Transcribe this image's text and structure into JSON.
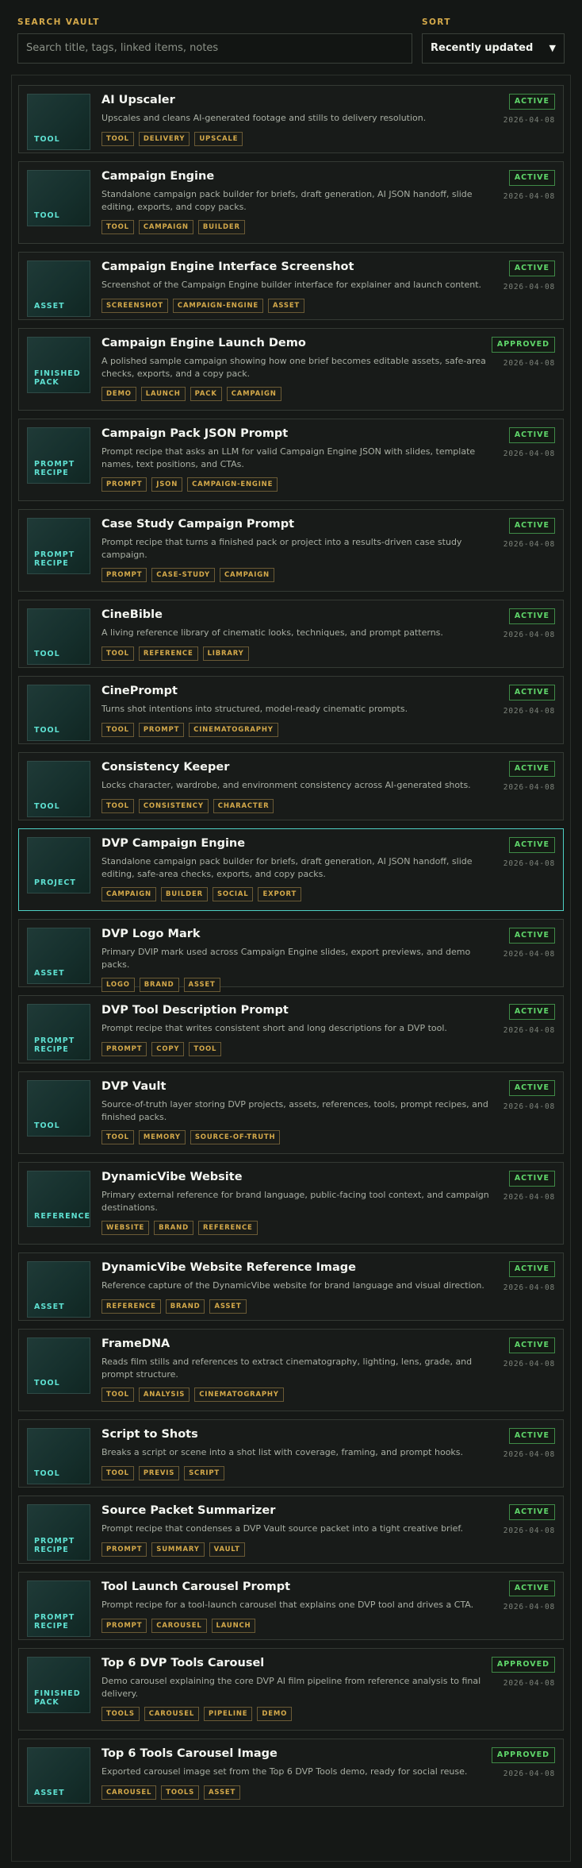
{
  "search": {
    "label": "SEARCH VAULT",
    "placeholder": "Search title, tags, linked items, notes"
  },
  "sort": {
    "label": "SORT",
    "value": "Recently updated"
  },
  "items": [
    {
      "type": "TOOL",
      "title": "AI Upscaler",
      "desc": "Upscales and cleans AI-generated footage and stills to delivery resolution.",
      "tags": [
        "TOOL",
        "DELIVERY",
        "UPSCALE"
      ],
      "status": "ACTIVE",
      "date": "2026-04-08"
    },
    {
      "type": "TOOL",
      "title": "Campaign Engine",
      "desc": "Standalone campaign pack builder for briefs, draft generation, AI JSON handoff, slide editing, exports, and copy packs.",
      "tags": [
        "TOOL",
        "CAMPAIGN",
        "BUILDER"
      ],
      "status": "ACTIVE",
      "date": "2026-04-08"
    },
    {
      "type": "ASSET",
      "title": "Campaign Engine Interface Screenshot",
      "desc": "Screenshot of the Campaign Engine builder interface for explainer and launch content.",
      "tags": [
        "SCREENSHOT",
        "CAMPAIGN-ENGINE",
        "ASSET"
      ],
      "status": "ACTIVE",
      "date": "2026-04-08"
    },
    {
      "type": "FINISHED PACK",
      "title": "Campaign Engine Launch Demo",
      "desc": "A polished sample campaign showing how one brief becomes editable assets, safe-area checks, exports, and a copy pack.",
      "tags": [
        "DEMO",
        "LAUNCH",
        "PACK",
        "CAMPAIGN"
      ],
      "status": "APPROVED",
      "date": "2026-04-08"
    },
    {
      "type": "PROMPT RECIPE",
      "title": "Campaign Pack JSON Prompt",
      "desc": "Prompt recipe that asks an LLM for valid Campaign Engine JSON with slides, template names, text positions, and CTAs.",
      "tags": [
        "PROMPT",
        "JSON",
        "CAMPAIGN-ENGINE"
      ],
      "status": "ACTIVE",
      "date": "2026-04-08"
    },
    {
      "type": "PROMPT RECIPE",
      "title": "Case Study Campaign Prompt",
      "desc": "Prompt recipe that turns a finished pack or project into a results-driven case study campaign.",
      "tags": [
        "PROMPT",
        "CASE-STUDY",
        "CAMPAIGN"
      ],
      "status": "ACTIVE",
      "date": "2026-04-08"
    },
    {
      "type": "TOOL",
      "title": "CineBible",
      "desc": "A living reference library of cinematic looks, techniques, and prompt patterns.",
      "tags": [
        "TOOL",
        "REFERENCE",
        "LIBRARY"
      ],
      "status": "ACTIVE",
      "date": "2026-04-08"
    },
    {
      "type": "TOOL",
      "title": "CinePrompt",
      "desc": "Turns shot intentions into structured, model-ready cinematic prompts.",
      "tags": [
        "TOOL",
        "PROMPT",
        "CINEMATOGRAPHY"
      ],
      "status": "ACTIVE",
      "date": "2026-04-08"
    },
    {
      "type": "TOOL",
      "title": "Consistency Keeper",
      "desc": "Locks character, wardrobe, and environment consistency across AI-generated shots.",
      "tags": [
        "TOOL",
        "CONSISTENCY",
        "CHARACTER"
      ],
      "status": "ACTIVE",
      "date": "2026-04-08"
    },
    {
      "type": "PROJECT",
      "title": "DVP Campaign Engine",
      "desc": "Standalone campaign pack builder for briefs, draft generation, AI JSON handoff, slide editing, safe-area checks, exports, and copy packs.",
      "tags": [
        "CAMPAIGN",
        "BUILDER",
        "SOCIAL",
        "EXPORT"
      ],
      "status": "ACTIVE",
      "date": "2026-04-08",
      "selected": true
    },
    {
      "type": "ASSET",
      "title": "DVP Logo Mark",
      "desc": "Primary DVIP mark used across Campaign Engine slides, export previews, and demo packs.",
      "tags": [
        "LOGO",
        "BRAND",
        "ASSET"
      ],
      "status": "ACTIVE",
      "date": "2026-04-08"
    },
    {
      "type": "PROMPT RECIPE",
      "title": "DVP Tool Description Prompt",
      "desc": "Prompt recipe that writes consistent short and long descriptions for a DVP tool.",
      "tags": [
        "PROMPT",
        "COPY",
        "TOOL"
      ],
      "status": "ACTIVE",
      "date": "2026-04-08"
    },
    {
      "type": "TOOL",
      "title": "DVP Vault",
      "desc": "Source-of-truth layer storing DVP projects, assets, references, tools, prompt recipes, and finished packs.",
      "tags": [
        "TOOL",
        "MEMORY",
        "SOURCE-OF-TRUTH"
      ],
      "status": "ACTIVE",
      "date": "2026-04-08"
    },
    {
      "type": "REFERENCE",
      "title": "DynamicVibe Website",
      "desc": "Primary external reference for brand language, public-facing tool context, and campaign destinations.",
      "tags": [
        "WEBSITE",
        "BRAND",
        "REFERENCE"
      ],
      "status": "ACTIVE",
      "date": "2026-04-08"
    },
    {
      "type": "ASSET",
      "title": "DynamicVibe Website Reference Image",
      "desc": "Reference capture of the DynamicVibe website for brand language and visual direction.",
      "tags": [
        "REFERENCE",
        "BRAND",
        "ASSET"
      ],
      "status": "ACTIVE",
      "date": "2026-04-08"
    },
    {
      "type": "TOOL",
      "title": "FrameDNA",
      "desc": "Reads film stills and references to extract cinematography, lighting, lens, grade, and prompt structure.",
      "tags": [
        "TOOL",
        "ANALYSIS",
        "CINEMATOGRAPHY"
      ],
      "status": "ACTIVE",
      "date": "2026-04-08"
    },
    {
      "type": "TOOL",
      "title": "Script to Shots",
      "desc": "Breaks a script or scene into a shot list with coverage, framing, and prompt hooks.",
      "tags": [
        "TOOL",
        "PREVIS",
        "SCRIPT"
      ],
      "status": "ACTIVE",
      "date": "2026-04-08"
    },
    {
      "type": "PROMPT RECIPE",
      "title": "Source Packet Summarizer",
      "desc": "Prompt recipe that condenses a DVP Vault source packet into a tight creative brief.",
      "tags": [
        "PROMPT",
        "SUMMARY",
        "VAULT"
      ],
      "status": "ACTIVE",
      "date": "2026-04-08"
    },
    {
      "type": "PROMPT RECIPE",
      "title": "Tool Launch Carousel Prompt",
      "desc": "Prompt recipe for a tool-launch carousel that explains one DVP tool and drives a CTA.",
      "tags": [
        "PROMPT",
        "CAROUSEL",
        "LAUNCH"
      ],
      "status": "ACTIVE",
      "date": "2026-04-08"
    },
    {
      "type": "FINISHED PACK",
      "title": "Top 6 DVP Tools Carousel",
      "desc": "Demo carousel explaining the core DVP AI film pipeline from reference analysis to final delivery.",
      "tags": [
        "TOOLS",
        "CAROUSEL",
        "PIPELINE",
        "DEMO"
      ],
      "status": "APPROVED",
      "date": "2026-04-08"
    },
    {
      "type": "ASSET",
      "title": "Top 6 Tools Carousel Image",
      "desc": "Exported carousel image set from the Top 6 DVP Tools demo, ready for social reuse.",
      "tags": [
        "CAROUSEL",
        "TOOLS",
        "ASSET"
      ],
      "status": "APPROVED",
      "date": "2026-04-08"
    }
  ]
}
